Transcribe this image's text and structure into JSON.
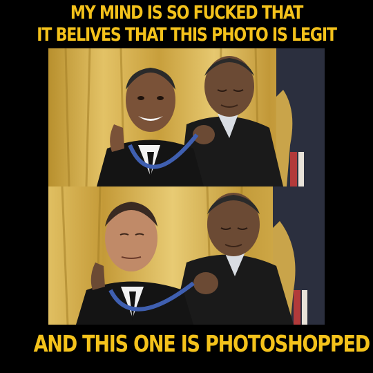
{
  "meme": {
    "top_caption_line1": "MY MIND IS SO FUCKED THAT",
    "top_caption_line2": "IT BELIVES THAT THIS PHOTO IS LEGIT",
    "bottom_caption": "AND THIS ONE IS PHOTOSHOPPED"
  },
  "colors": {
    "background": "#000000",
    "caption_text": "#f4c21b",
    "curtain": "#d6b04a",
    "suit": "#151515",
    "medal_ribbon": "#3f5fb0"
  },
  "images": {
    "top_photo": "medal-ceremony-photo-1",
    "bottom_photo": "medal-ceremony-photo-2"
  }
}
